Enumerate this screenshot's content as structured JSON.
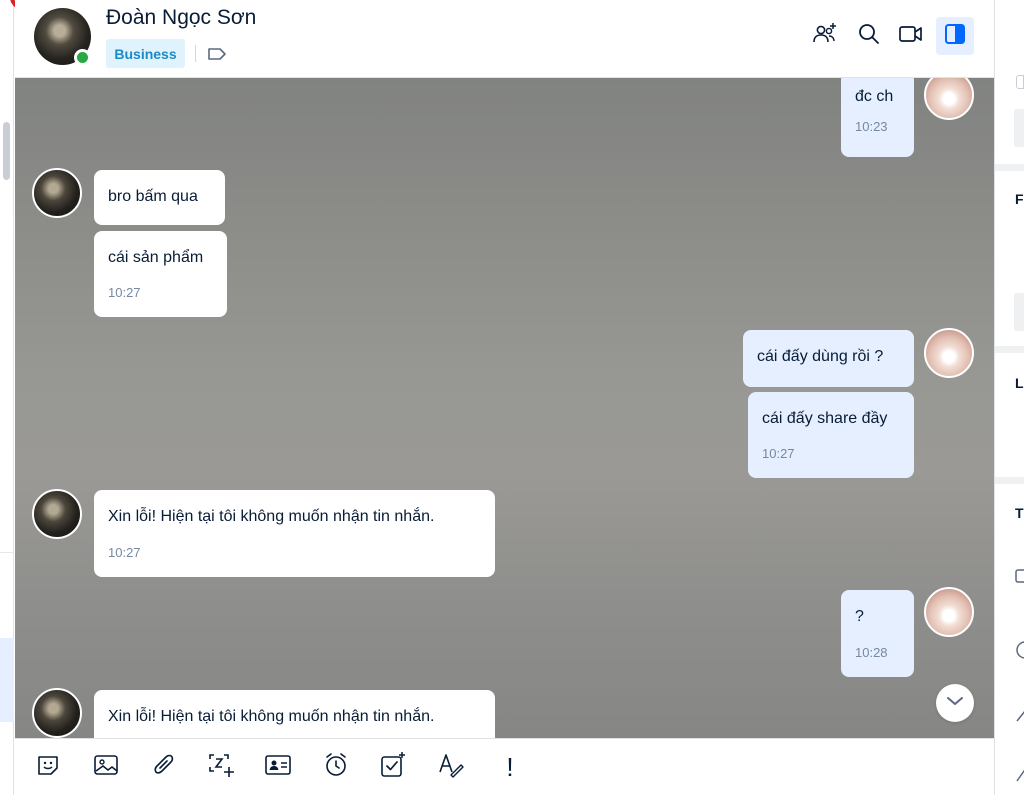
{
  "header": {
    "contact_name": "Đoàn Ngọc Sơn",
    "tag": "Business",
    "online": true,
    "actions": [
      {
        "name": "add-to-group-icon"
      },
      {
        "name": "search-icon"
      },
      {
        "name": "video-call-icon"
      },
      {
        "name": "conversation-info-toggle-icon",
        "active": true
      }
    ]
  },
  "messages": [
    {
      "direction": "outgoing",
      "text": "đc ch",
      "time": "10:23"
    },
    {
      "direction": "incoming",
      "text": "bro bấm qua",
      "time": ""
    },
    {
      "direction": "incoming",
      "text": "cái sản phẩm",
      "time": "10:27"
    },
    {
      "direction": "outgoing",
      "text": "cái đấy dùng rồi ?",
      "time": ""
    },
    {
      "direction": "outgoing",
      "text": "cái đấy share đầy",
      "time": "10:27"
    },
    {
      "direction": "incoming",
      "text": "Xin lỗi! Hiện tại tôi không muốn nhận tin nhắn.",
      "time": "10:27"
    },
    {
      "direction": "outgoing",
      "text": "?",
      "time": "10:28"
    },
    {
      "direction": "incoming",
      "text": "Xin lỗi! Hiện tại tôi không muốn nhận tin nhắn.",
      "time": ""
    }
  ],
  "toolbar": {
    "items": [
      "sticker-icon",
      "image-icon",
      "attach-file-icon",
      "screenshot-icon",
      "contact-card-icon",
      "reminder-icon",
      "task-icon",
      "text-format-icon",
      "urgent-mark-icon"
    ],
    "urgent_glyph": "!"
  },
  "right_panel": {
    "letters": [
      "F",
      "L",
      "T"
    ]
  },
  "colors": {
    "accent": "#0068ff",
    "outgoing_bubble": "#e5efff",
    "incoming_bubble": "#ffffff",
    "tag_bg": "#e0f2fb",
    "tag_text": "#1a8bc8",
    "online": "#28a745",
    "time_text": "#7589a3"
  }
}
